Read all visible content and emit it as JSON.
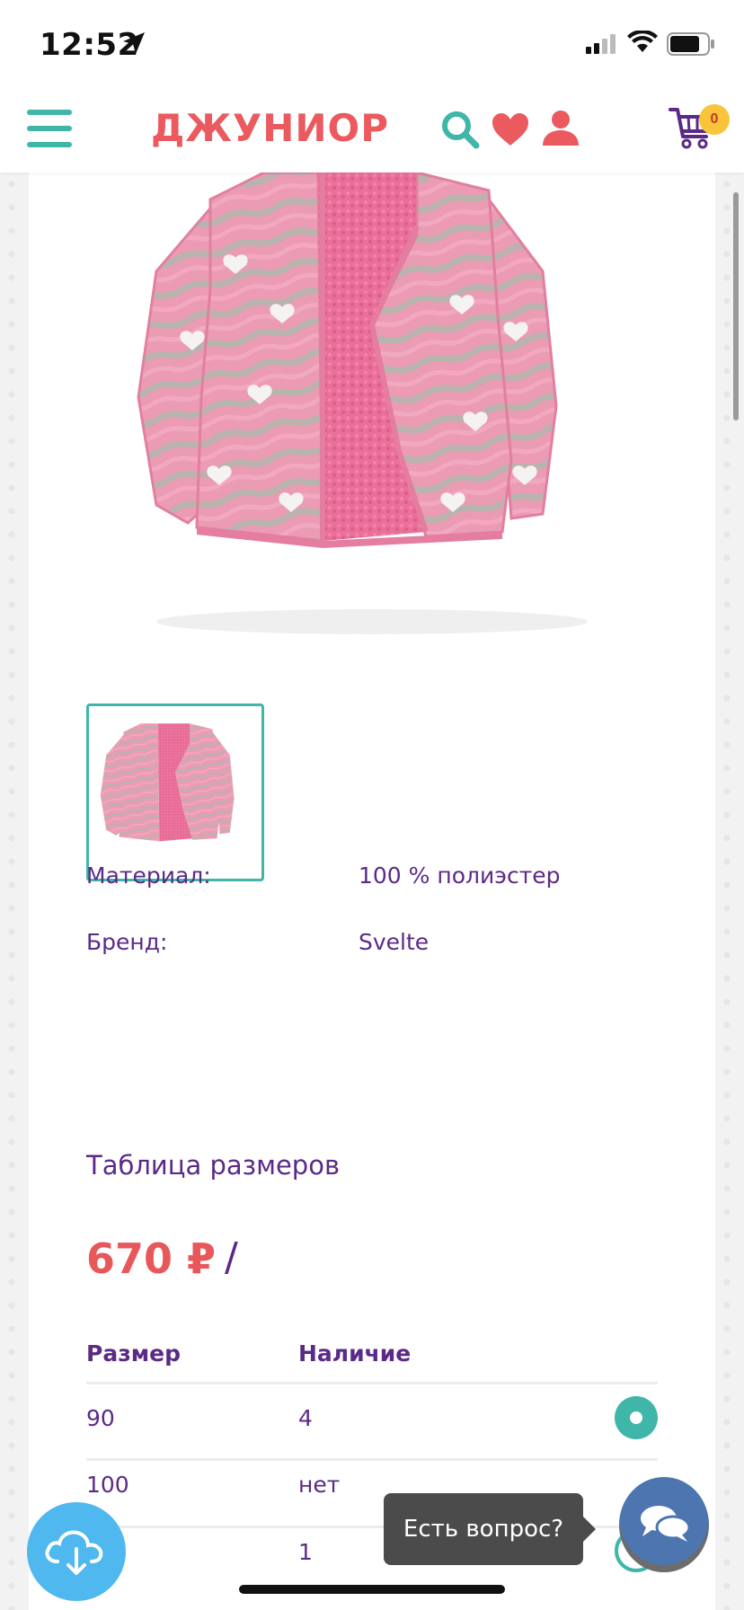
{
  "status_bar": {
    "time": "12:52",
    "icons": [
      "location-arrow-icon",
      "signal-icon",
      "wifi-icon",
      "battery-icon"
    ]
  },
  "header": {
    "logo": "ДЖУНИОР",
    "cart_count": "0",
    "icons": [
      "menu-icon",
      "search-icon",
      "heart-icon",
      "user-icon",
      "cart-icon"
    ]
  },
  "product": {
    "image_alt": "pink fleece jacket with hearts",
    "specs": [
      {
        "label": "Материал:",
        "value": "100 % полиэстер"
      },
      {
        "label": "Бренд:",
        "value": "Svelte"
      }
    ],
    "size_table_link": "Таблица размеров",
    "price": "670 ₽",
    "price_separator": "/",
    "table": {
      "headers": [
        "Размер",
        "Наличие"
      ],
      "rows": [
        {
          "size": "90",
          "availability": "4",
          "selected": true
        },
        {
          "size": "100",
          "availability": "нет",
          "selected": false
        },
        {
          "size": "",
          "availability": "1",
          "selected": false
        }
      ]
    }
  },
  "chat": {
    "tooltip": "Есть вопрос?"
  },
  "colors": {
    "accent_teal": "#3fb6a8",
    "brand_red": "#ea5a5e",
    "text_purple": "#5b2a86",
    "download_blue": "#4fb8ef",
    "chat_blue": "#4d76b0"
  }
}
